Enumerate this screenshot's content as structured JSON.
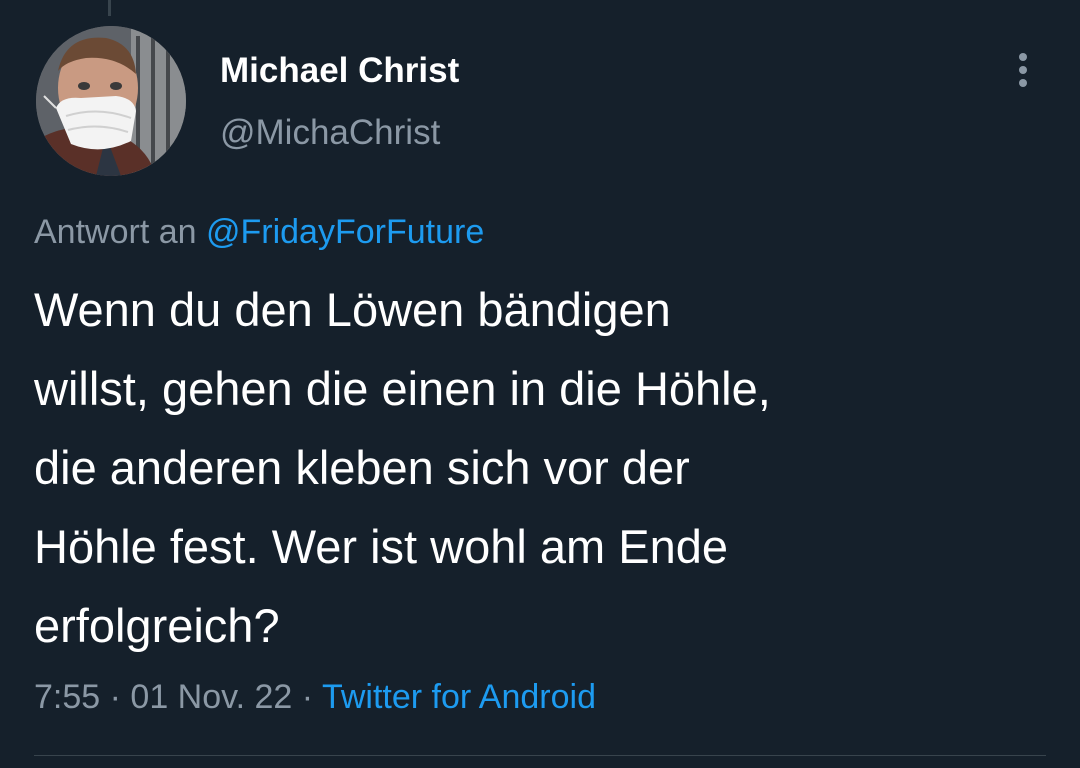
{
  "author": {
    "name": "Michael Christ",
    "handle": "@MichaChrist",
    "avatar": "profile-photo-man-with-ffp2-mask"
  },
  "reply": {
    "prefix": "Antwort an",
    "mention": "@FridayForFuture"
  },
  "tweet": {
    "lines": [
      "Wenn du den Löwen bändigen",
      "willst, gehen die einen in die Höhle,",
      "die anderen kleben sich vor der",
      "Höhle fest. Wer ist wohl am Ende",
      "erfolgreich?"
    ]
  },
  "meta": {
    "time": "7:55",
    "separator": "·",
    "date": "01 Nov. 22",
    "source": "Twitter for Android"
  },
  "icons": {
    "more": "more-vertical-icon"
  },
  "colors": {
    "background": "#15202b",
    "primary_text": "#ffffff",
    "secondary_text": "#8b98a5",
    "link": "#1d9bf0",
    "divider": "#38444d"
  }
}
